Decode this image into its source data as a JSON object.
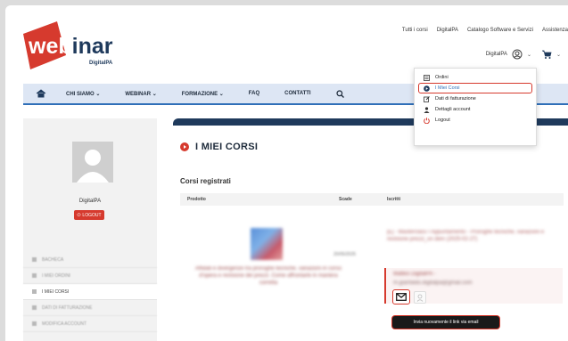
{
  "header": {
    "logo_text": "webinar",
    "logo_sub": "DigitalPA",
    "top_links": [
      "Tutti i corsi",
      "DigitalPA",
      "Catalogo Software e Servizi",
      "Assistenza"
    ],
    "account_name": "DigitalPA"
  },
  "nav": {
    "items": [
      "CHI SIAMO",
      "WEBINAR",
      "FORMAZIONE",
      "FAQ",
      "CONTATTI"
    ],
    "dropdown_marker": "⌄"
  },
  "account_menu": {
    "items": [
      {
        "label": "Ordini",
        "icon": "orders-icon"
      },
      {
        "label": "I Miei Corsi",
        "icon": "play-circle-icon",
        "active": true
      },
      {
        "label": "Dati di fatturazione",
        "icon": "edit-icon"
      },
      {
        "label": "Dettagli account",
        "icon": "user-icon"
      },
      {
        "label": "Logout",
        "icon": "power-icon"
      }
    ]
  },
  "sidebar": {
    "name": "DigitalPA",
    "logout_label": "LOGOUT",
    "menu": [
      {
        "label": "BACHECA"
      },
      {
        "label": "I MIEI ORDINI"
      },
      {
        "label": "I MIEI CORSI",
        "active": true
      },
      {
        "label": "DATI DI FATTURAZIONE"
      },
      {
        "label": "MODIFICA ACCOUNT"
      }
    ]
  },
  "main": {
    "title": "I MIEI CORSI",
    "subtitle": "Corsi registrati",
    "columns": [
      "Prodotto",
      "Scade",
      "Iscritti"
    ],
    "course_title": "[E] - Masterclass I Appuntamento - Proroghe tecniche, variazioni e revisione prezzi_on dem (2025-02-27)",
    "course_desc": "Affidati e divergenze tra proroghe tecniche, variazioni in corso d'opera e revisione dei prezzi. Come affrontarle in maniera corretta",
    "expires": "20/05/2025",
    "enrollee_name": "Matteo DigitalPA -",
    "enrollee_email": "m.gianfaldo.digitalpa@gmail.com",
    "tooltip": "Invia nuovamente il link via email"
  },
  "colors": {
    "brand_red": "#d63a2e",
    "nav_bg": "#dde6f4",
    "dark_bar": "#1f3a5c",
    "link_blue": "#2f6fb8"
  }
}
